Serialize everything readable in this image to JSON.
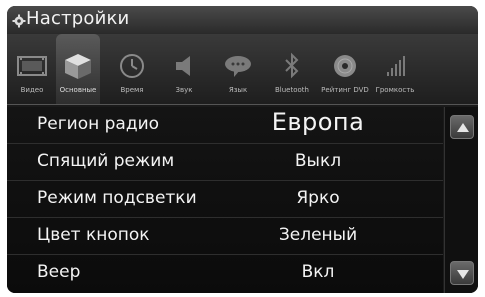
{
  "window": {
    "title": "Настройки",
    "title_icon": "gear-icon"
  },
  "tabs": [
    {
      "label": "Видео",
      "icon": "video-icon",
      "active": false
    },
    {
      "label": "Основные",
      "icon": "cube-icon",
      "active": true
    },
    {
      "label": "Время",
      "icon": "clock-icon",
      "active": false
    },
    {
      "label": "Звук",
      "icon": "speaker-icon",
      "active": false
    },
    {
      "label": "Язык",
      "icon": "speech-bubble-icon",
      "active": false
    },
    {
      "label": "Bluetooth",
      "icon": "bluetooth-icon",
      "active": false
    },
    {
      "label": "Рейтинг DVD",
      "icon": "disc-icon",
      "active": false
    },
    {
      "label": "Громкость",
      "icon": "volume-bars-icon",
      "active": false
    }
  ],
  "settings": [
    {
      "label": "Регион радио",
      "value": "Европа"
    },
    {
      "label": "Спящий режим",
      "value": "Выкл"
    },
    {
      "label": "Режим подсветки",
      "value": "Ярко"
    },
    {
      "label": "Цвет кнопок",
      "value": "Зеленый"
    },
    {
      "label": "Веер",
      "value": "Вкл"
    }
  ],
  "scroll": {
    "up_icon": "arrow-up-icon",
    "down_icon": "arrow-down-icon"
  }
}
